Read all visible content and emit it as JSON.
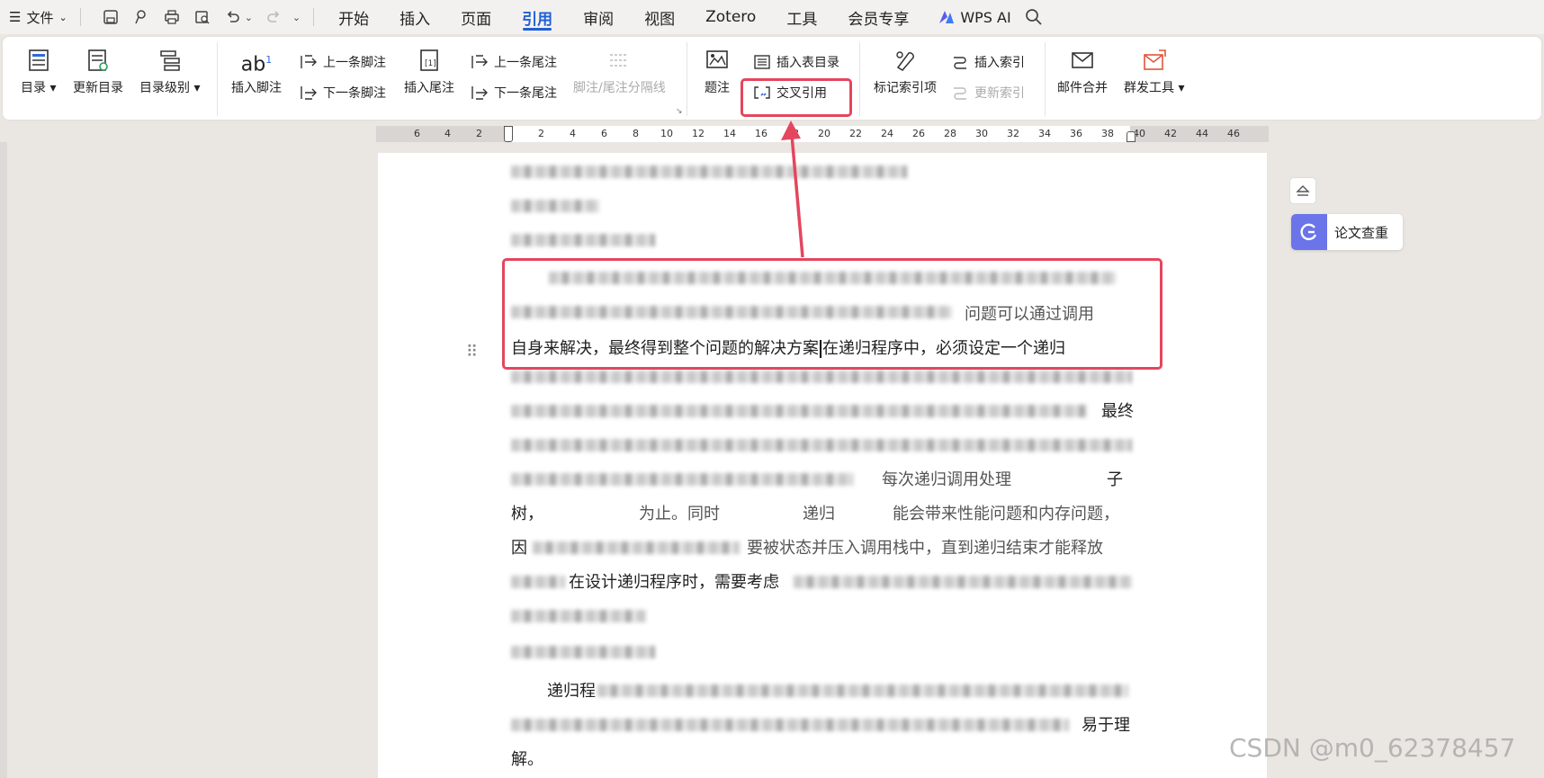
{
  "menubar": {
    "file_label": "文件",
    "tabs": [
      "开始",
      "插入",
      "页面",
      "引用",
      "审阅",
      "视图",
      "Zotero",
      "工具",
      "会员专享"
    ],
    "active_tab": "引用",
    "wps_ai": "WPS AI"
  },
  "ribbon": {
    "toc": "目录",
    "update_toc": "更新目录",
    "toc_level": "目录级别",
    "insert_footnote": "插入脚注",
    "prev_footnote": "上一条脚注",
    "next_footnote": "下一条脚注",
    "insert_endnote": "插入尾注",
    "prev_endnote": "上一条尾注",
    "next_endnote": "下一条尾注",
    "separator": "脚注/尾注分隔线",
    "caption": "题注",
    "insert_table_toc": "插入表目录",
    "cross_ref": "交叉引用",
    "mark_index": "标记索引项",
    "insert_index": "插入索引",
    "update_index": "更新索引",
    "mail_merge": "邮件合并",
    "group_tools": "群发工具"
  },
  "ruler": {
    "ticks": [
      "6",
      "4",
      "2",
      "2",
      "4",
      "6",
      "8",
      "10",
      "12",
      "14",
      "16",
      "18",
      "20",
      "22",
      "24",
      "26",
      "28",
      "30",
      "32",
      "34",
      "36",
      "38",
      "40",
      "42",
      "44",
      "46"
    ]
  },
  "document": {
    "line3_text": "自身来解决，最终得到整个问题的解决方案",
    "line3_after": "在递归程序中，必须设定一个递归",
    "frag_a": "问题可以通过调用",
    "frag_b": "最终",
    "frag_c": "每次递归调用处理",
    "frag_d": "子",
    "frag_e": "树，",
    "frag_f": "为止。同时",
    "frag_g": "递归",
    "frag_h": "能会带来性能问题和内存问题，",
    "frag_i": "因",
    "frag_j": "要被状态并压入调用栈中，直到递归结束才能释放",
    "frag_k": "在设计递归程序时，需要考虑",
    "frag_l": "递归程",
    "frag_m": "易于理",
    "frag_n": "解。"
  },
  "side": {
    "paper_check": "论文查重"
  },
  "watermark": "CSDN @m0_62378457",
  "colors": {
    "accent": "#1f5fd6",
    "highlight": "#e4465e",
    "paper_check": "#6b74e8"
  }
}
